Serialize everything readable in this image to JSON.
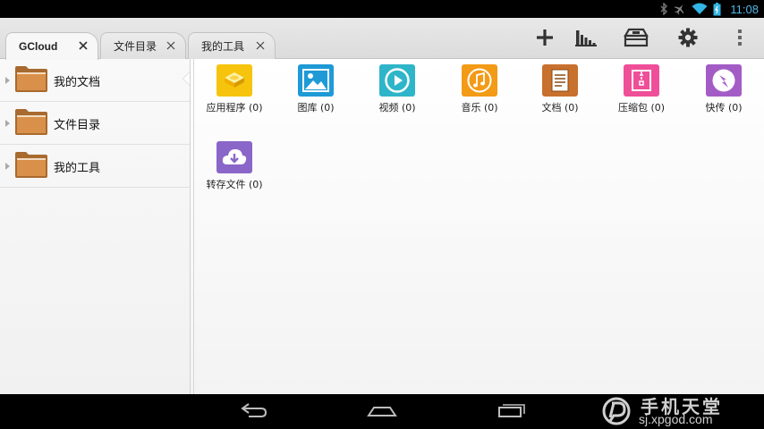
{
  "status_bar": {
    "time": "11:08",
    "icons": [
      "bluetooth-icon",
      "airplane-icon",
      "wifi-icon",
      "battery-icon"
    ]
  },
  "tabs": [
    {
      "label": "GCloud",
      "active": true
    },
    {
      "label": "文件目录",
      "active": false
    },
    {
      "label": "我的工具",
      "active": false
    }
  ],
  "toolbar": {
    "icons": [
      "add-icon",
      "stats-icon",
      "toolbox-icon",
      "settings-icon",
      "overflow-menu-icon"
    ]
  },
  "sidebar": {
    "items": [
      {
        "label": "我的文档",
        "selected": true
      },
      {
        "label": "文件目录",
        "selected": false
      },
      {
        "label": "我的工具",
        "selected": false
      }
    ]
  },
  "categories": [
    {
      "label": "应用程序 (0)",
      "icon": "app-icon",
      "color": "#f6c40c"
    },
    {
      "label": "图库 (0)",
      "icon": "gallery-icon",
      "color": "#1e9ad6"
    },
    {
      "label": "视频 (0)",
      "icon": "video-icon",
      "color": "#2fb5c9"
    },
    {
      "label": "音乐 (0)",
      "icon": "music-icon",
      "color": "#f39a16"
    },
    {
      "label": "文档 (0)",
      "icon": "document-icon",
      "color": "#c8702e"
    },
    {
      "label": "压缩包 (0)",
      "icon": "archive-icon",
      "color": "#ef4f98"
    },
    {
      "label": "快传 (0)",
      "icon": "quick-transfer-icon",
      "color": "#a35cc6"
    },
    {
      "label": "转存文件 (0)",
      "icon": "cloud-download-icon",
      "color": "#8a66c9"
    }
  ],
  "navbar": {
    "icons": [
      "back-icon",
      "home-icon",
      "recent-apps-icon"
    ]
  },
  "watermark": {
    "name": "手机天堂",
    "url": "sj.xpgod.com"
  }
}
